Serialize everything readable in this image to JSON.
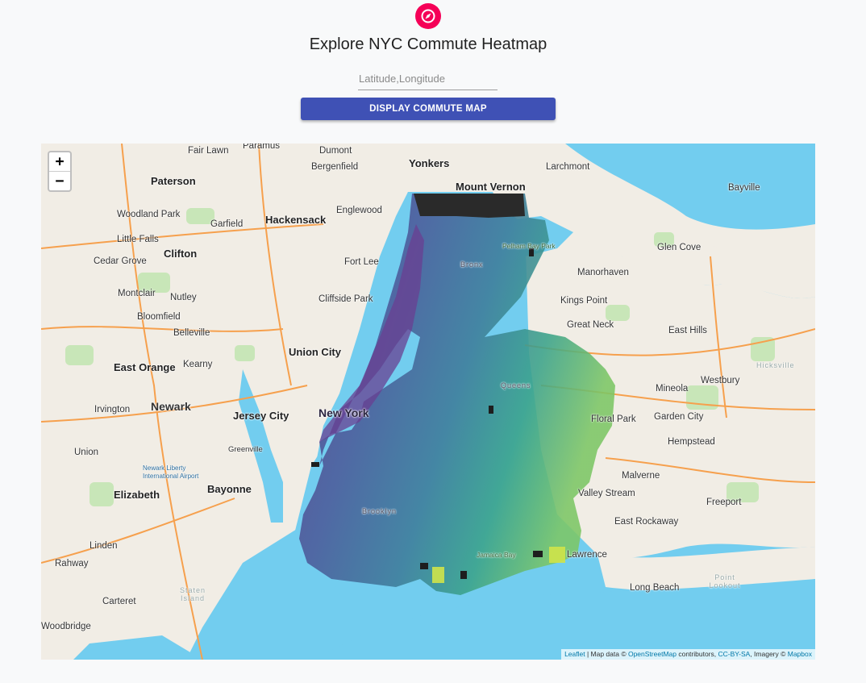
{
  "header": {
    "icon": "compass-icon",
    "accent_color": "#f50057",
    "title": "Explore NYC Commute Heatmap"
  },
  "form": {
    "input_placeholder": "Latitude,Longitude",
    "input_value": "",
    "button_label": "DISPLAY COMMUTE MAP",
    "button_color": "#3f51b5"
  },
  "map": {
    "zoom_in_label": "+",
    "zoom_out_label": "−",
    "attribution": {
      "leaflet": "Leaflet",
      "text1": " | Map data © ",
      "osm": "OpenStreetMap",
      "text2": " contributors, ",
      "license": "CC-BY-SA",
      "text3": ", Imagery © ",
      "mapbox": "Mapbox"
    },
    "place_labels": [
      "Fair Lawn",
      "Paramus",
      "Dumont",
      "Yonkers",
      "Larchmont",
      "Paterson",
      "Bergenfield",
      "Mount Vernon",
      "Woodland Park",
      "Hackensack",
      "Englewood",
      "Bayville",
      "Garfield",
      "Little Falls",
      "Cedar Grove",
      "Clifton",
      "Fort Lee",
      "Glen Cove",
      "Manorhaven",
      "Montclair",
      "Nutley",
      "Cliffside Park",
      "Kings Point",
      "Bloomfield",
      "Great Neck",
      "East Hills",
      "Belleville",
      "Union City",
      "East Orange",
      "Kearny",
      "Westbury",
      "Mineola",
      "Irvington",
      "Newark",
      "Jersey City",
      "New York",
      "Floral Park",
      "Garden City",
      "Union",
      "Greenville",
      "Hempstead",
      "Newark Liberty International Airport",
      "Malverne",
      "Elizabeth",
      "Bayonne",
      "Valley Stream",
      "Freeport",
      "East Rockaway",
      "Linden",
      "Lawrence",
      "Rahway",
      "Long Beach",
      "Carteret",
      "Woodbridge",
      "Pelham Bay Park",
      "Jamaica Bay",
      "Staten Island",
      "Hicksville",
      "Point Lookout",
      "Brooklyn",
      "Queens",
      "Bronx"
    ]
  }
}
